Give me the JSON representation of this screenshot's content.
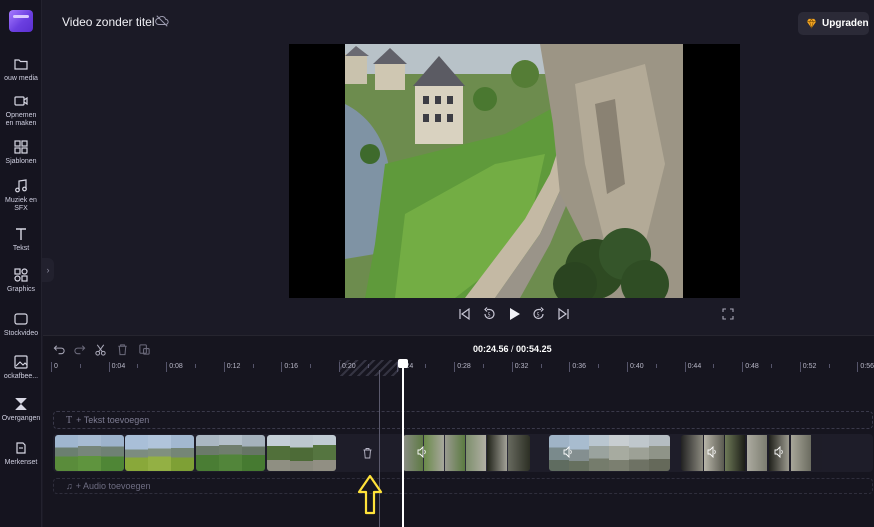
{
  "app": {
    "project_title": "Video zonder titel",
    "upgrade_label": "Upgraden",
    "accent_color": "#7b4fff",
    "upgrade_gem_color": "#f5a623"
  },
  "sidebar": {
    "items": [
      {
        "label": "ouw media",
        "icon": "folder-icon"
      },
      {
        "label": "Opnemen\nen maken",
        "icon": "camera-icon"
      },
      {
        "label": "Sjablonen",
        "icon": "templates-icon"
      },
      {
        "label": "Muziek en\nSFX",
        "icon": "music-icon"
      },
      {
        "label": "Tekst",
        "icon": "text-icon"
      },
      {
        "label": "Graphics",
        "icon": "shapes-icon"
      },
      {
        "label": "Stockvideo",
        "icon": "stock-video-icon"
      },
      {
        "label": "ockafbee...",
        "icon": "image-icon"
      },
      {
        "label": "Overgangen",
        "icon": "transitions-icon"
      },
      {
        "label": "Merkenset",
        "icon": "brand-kit-icon"
      }
    ]
  },
  "timeline": {
    "current_time": "00:24.56",
    "separator": " / ",
    "total_time": "00:54.25",
    "ruler_labels": [
      "0",
      "0:04",
      "0:08",
      "0:12",
      "0:16",
      "0:20",
      "0:24",
      "0:28",
      "0:32",
      "0:36",
      "0:40",
      "0:44",
      "0:48",
      "0:52",
      "0:56"
    ],
    "text_track_label": "+ Tekst toevoegen",
    "audio_track_label": "+ Audio toevoegen"
  }
}
